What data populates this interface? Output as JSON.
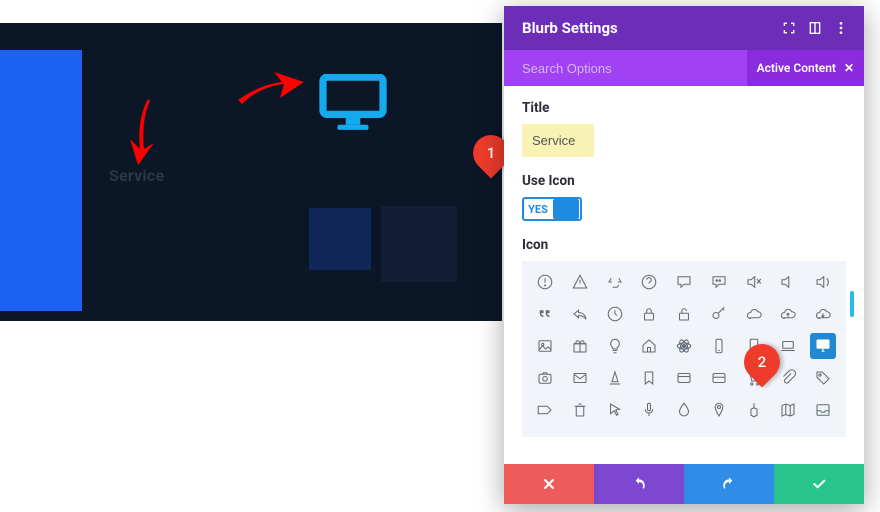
{
  "preview": {
    "service_label": "Service"
  },
  "panel": {
    "title": "Blurb Settings",
    "search_placeholder": "Search Options",
    "filter_tag": "Active Content"
  },
  "fields": {
    "title_label": "Title",
    "title_value": "Service",
    "use_icon_label": "Use Icon",
    "use_icon_value": "YES",
    "icon_label": "Icon"
  },
  "callouts": {
    "one": "1",
    "two": "2"
  },
  "icons": {
    "row0": [
      "exclamation",
      "warning",
      "recycle",
      "question",
      "speech",
      "speech-dots",
      "vol-mute",
      "vol-low",
      "vol-hi"
    ],
    "row1": [
      "quote",
      "reply",
      "clock",
      "lock",
      "lock-open",
      "key",
      "cloud",
      "cloud-up",
      "cloud-down"
    ],
    "row2": [
      "image",
      "gift",
      "bulb",
      "home",
      "atom",
      "phone",
      "phone2",
      "laptop",
      "monitor"
    ],
    "row3": [
      "camera",
      "mail",
      "cone",
      "bookmark",
      "card",
      "card2",
      "cart",
      "clip",
      "tag"
    ],
    "row4": [
      "label",
      "trash",
      "cursor",
      "mic",
      "drop",
      "pin",
      "thumb",
      "map",
      "inbox"
    ]
  },
  "selected_icon": "monitor",
  "colors": {
    "accent_purple": "#6c2eb9",
    "accent_light": "#a041f3",
    "blue": "#1f8be0",
    "red": "#ef5b5b",
    "green": "#29c48c"
  }
}
